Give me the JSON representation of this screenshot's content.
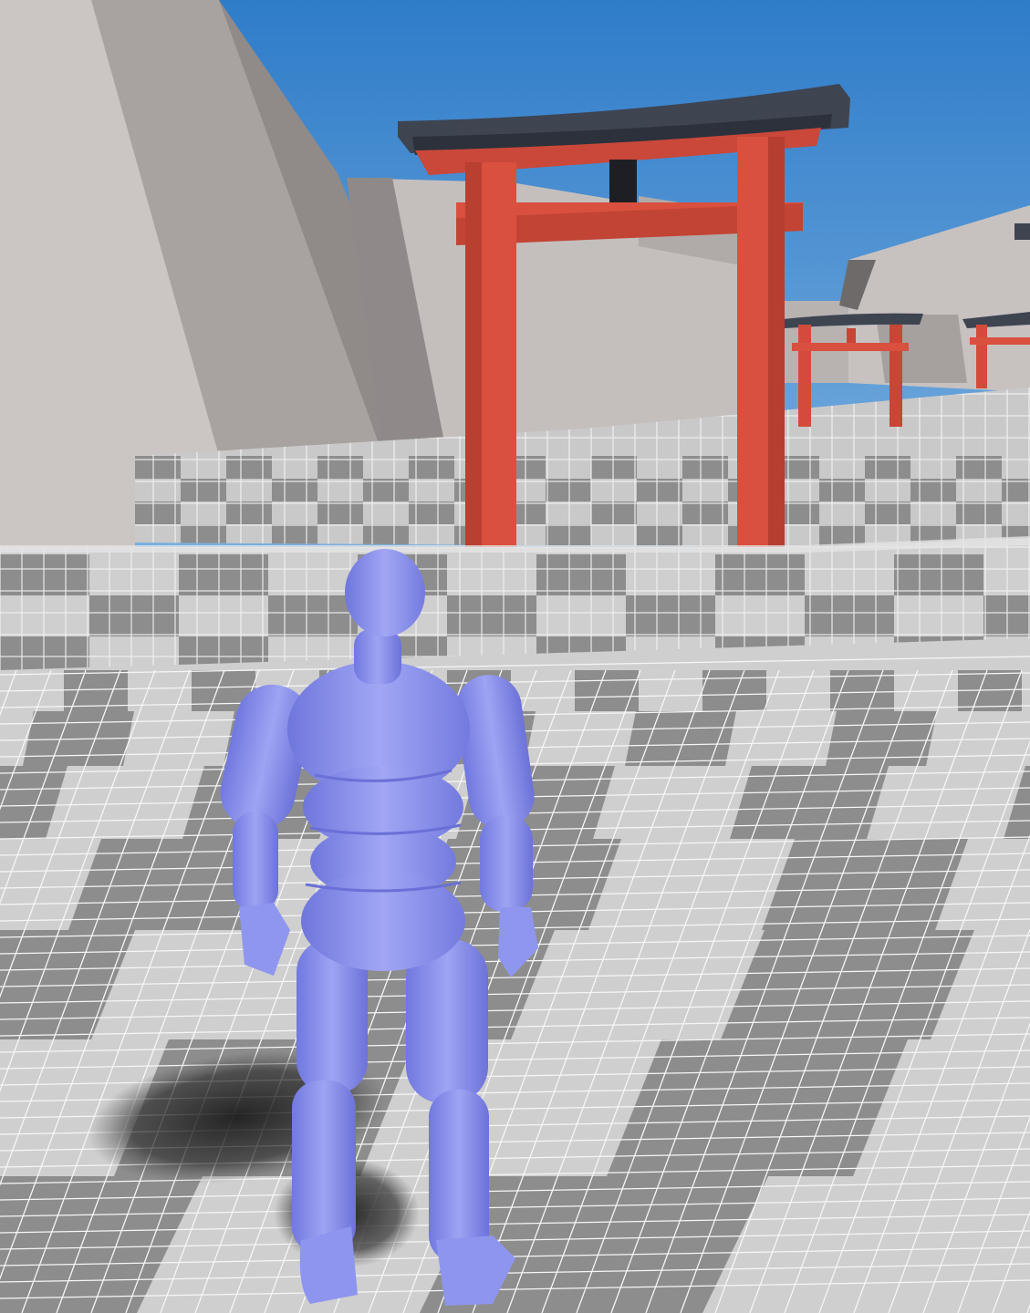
{
  "scene": {
    "type": "third-person game viewport",
    "colors": {
      "sky_top": "#2f7cc9",
      "sky_bottom": "#7fb3e0",
      "cliff_light": "#c7c2c0",
      "cliff_mid": "#a9a3a1",
      "cliff_dark": "#807b7a",
      "torii_red": "#d9503f",
      "torii_red_dark": "#a8382c",
      "torii_roof": "#3e4450",
      "grid_light": "#d6d6d6",
      "grid_dark": "#8d8d8d",
      "grid_line": "#f4f4f4",
      "mannequin": "#8f96ef",
      "mannequin_shade": "#6a70d6",
      "shadow": "#2b2b2b"
    },
    "elements": {
      "sky": "sky",
      "cliffs": "rock-cliff",
      "main_torii": "torii-gate",
      "distant_torii": "torii-gate",
      "platform": "checker-grid-platform",
      "floor": "checker-grid-floor",
      "player": "mannequin-character"
    }
  }
}
